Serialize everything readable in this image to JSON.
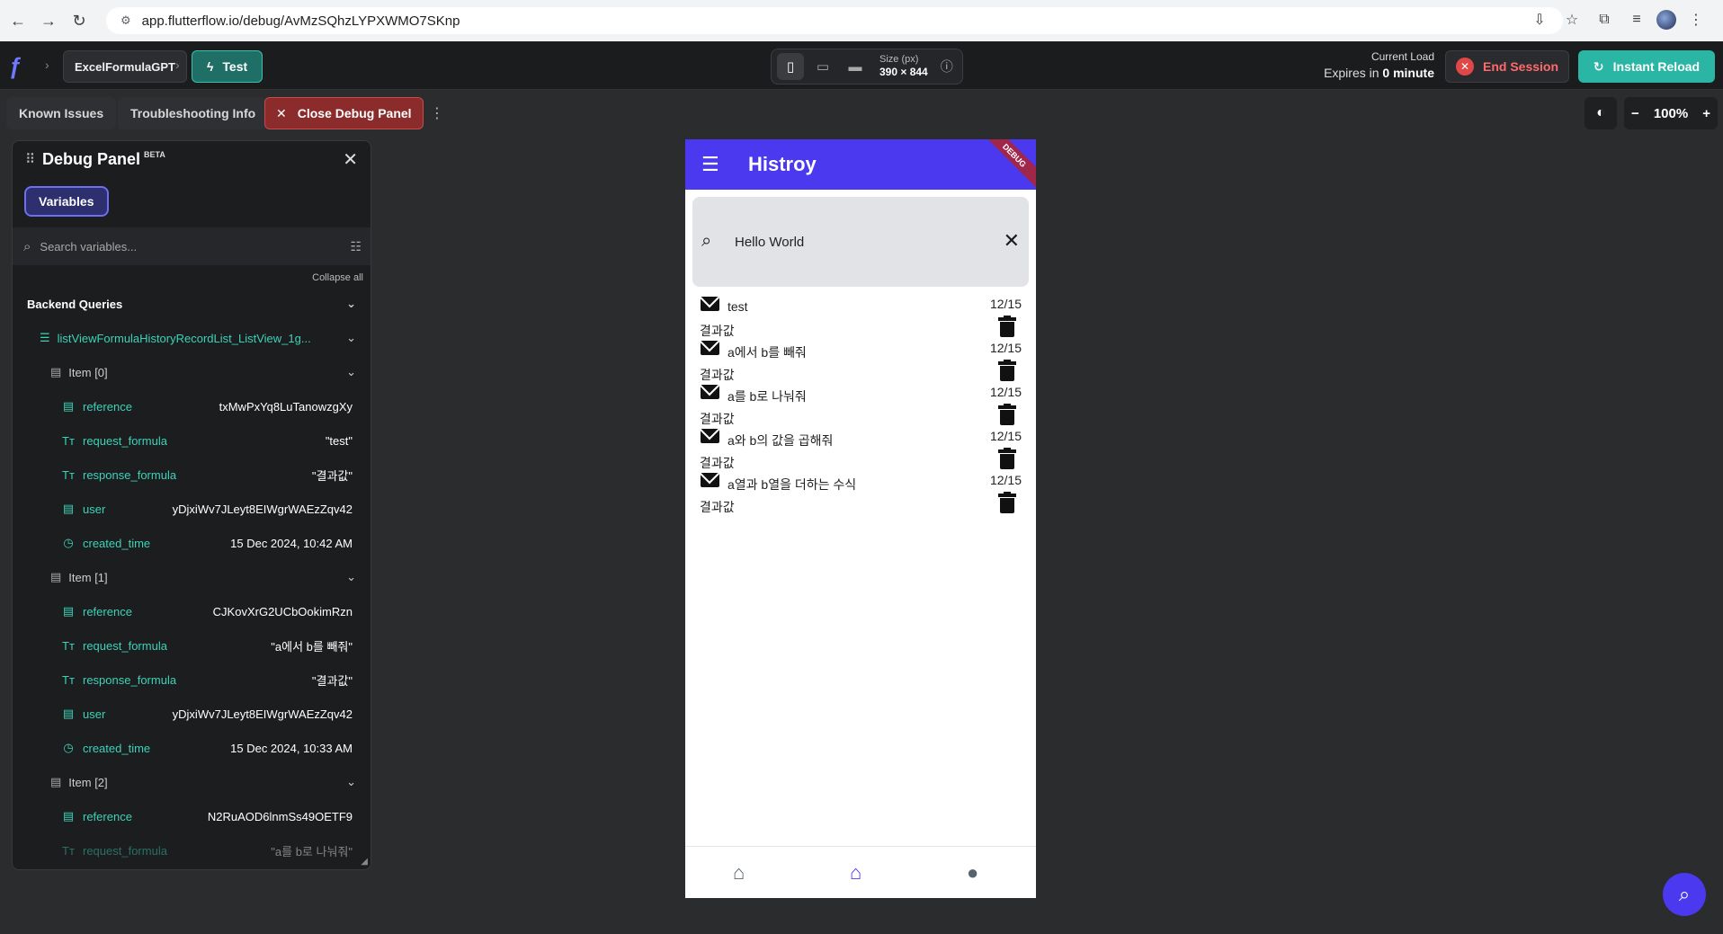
{
  "browser": {
    "url": "app.flutterflow.io/debug/AvMzSQhzLYPXWMO7SKnp",
    "icons": [
      "back-icon",
      "forward-icon",
      "reload-icon",
      "site-info-icon",
      "install-icon",
      "star-icon",
      "extensions-icon",
      "media-icon",
      "avatar"
    ]
  },
  "header": {
    "project_name": "ExcelFormulaGPT",
    "test_label": "Test",
    "size_label": "Size (px)",
    "size_value": "390 × 844",
    "current_load_label": "Current Load",
    "expires_prefix": "Expires in ",
    "expires_value": "0 minute",
    "end_session_label": "End Session",
    "instant_reload_label": "Instant Reload"
  },
  "toolbar": {
    "known_issues": "Known Issues",
    "troubleshooting": "Troubleshooting Info",
    "close_debug": "Close Debug Panel",
    "zoom": "100%"
  },
  "debug_panel": {
    "title": "Debug Panel",
    "beta": "BETA",
    "variables_tab": "Variables",
    "search_placeholder": "Search variables...",
    "collapse_all": "Collapse all",
    "section_title": "Backend Queries",
    "list_name": "listViewFormulaHistoryRecordList_ListView_1g...",
    "items": [
      {
        "title": "Item [0]",
        "fields": [
          {
            "name": "reference",
            "value": "txMwPxYq8LuTanowzgXy",
            "icon": "table-icon"
          },
          {
            "name": "request_formula",
            "value": "\"test\"",
            "icon": "text-icon"
          },
          {
            "name": "response_formula",
            "value": "\"결과값\"",
            "icon": "text-icon"
          },
          {
            "name": "user",
            "value": "yDjxiWv7JLeyt8EIWgrWAEzZqv42",
            "icon": "table-icon"
          },
          {
            "name": "created_time",
            "value": "15 Dec 2024, 10:42 AM",
            "icon": "clock-icon"
          }
        ]
      },
      {
        "title": "Item [1]",
        "fields": [
          {
            "name": "reference",
            "value": "CJKovXrG2UCbOokimRzn",
            "icon": "table-icon"
          },
          {
            "name": "request_formula",
            "value": "\"a에서 b를 빼줘\"",
            "icon": "text-icon"
          },
          {
            "name": "response_formula",
            "value": "\"결과값\"",
            "icon": "text-icon"
          },
          {
            "name": "user",
            "value": "yDjxiWv7JLeyt8EIWgrWAEzZqv42",
            "icon": "table-icon"
          },
          {
            "name": "created_time",
            "value": "15 Dec 2024, 10:33 AM",
            "icon": "clock-icon"
          }
        ]
      },
      {
        "title": "Item [2]",
        "fields": [
          {
            "name": "reference",
            "value": "N2RuAOD6lnmSs49OETF9",
            "icon": "table-icon"
          },
          {
            "name": "request_formula",
            "value": "\"a를 b로 나눠줘\"",
            "icon": "text-icon"
          }
        ]
      }
    ]
  },
  "phone": {
    "app_title": "Histroy",
    "debug_ribbon": "DEBUG",
    "search_text": "Hello World",
    "history": [
      {
        "request": "test",
        "response": "결과값",
        "date": "12/15"
      },
      {
        "request": "a에서 b를 빼줘",
        "response": "결과값",
        "date": "12/15"
      },
      {
        "request": "a를 b로 나눠줘",
        "response": "결과값",
        "date": "12/15"
      },
      {
        "request": "a와 b의 값을 곱해줘",
        "response": "결과값",
        "date": "12/15"
      },
      {
        "request": " a열과 b열을 더하는 수식",
        "response": "결과값",
        "date": "12/15"
      }
    ],
    "bottom_nav": [
      "home-icon",
      "home-icon",
      "person-icon"
    ],
    "active_tab_index": 1
  },
  "colors": {
    "primary": "#4b39ef",
    "teal": "#2bb5a4",
    "danger": "#e04848"
  }
}
